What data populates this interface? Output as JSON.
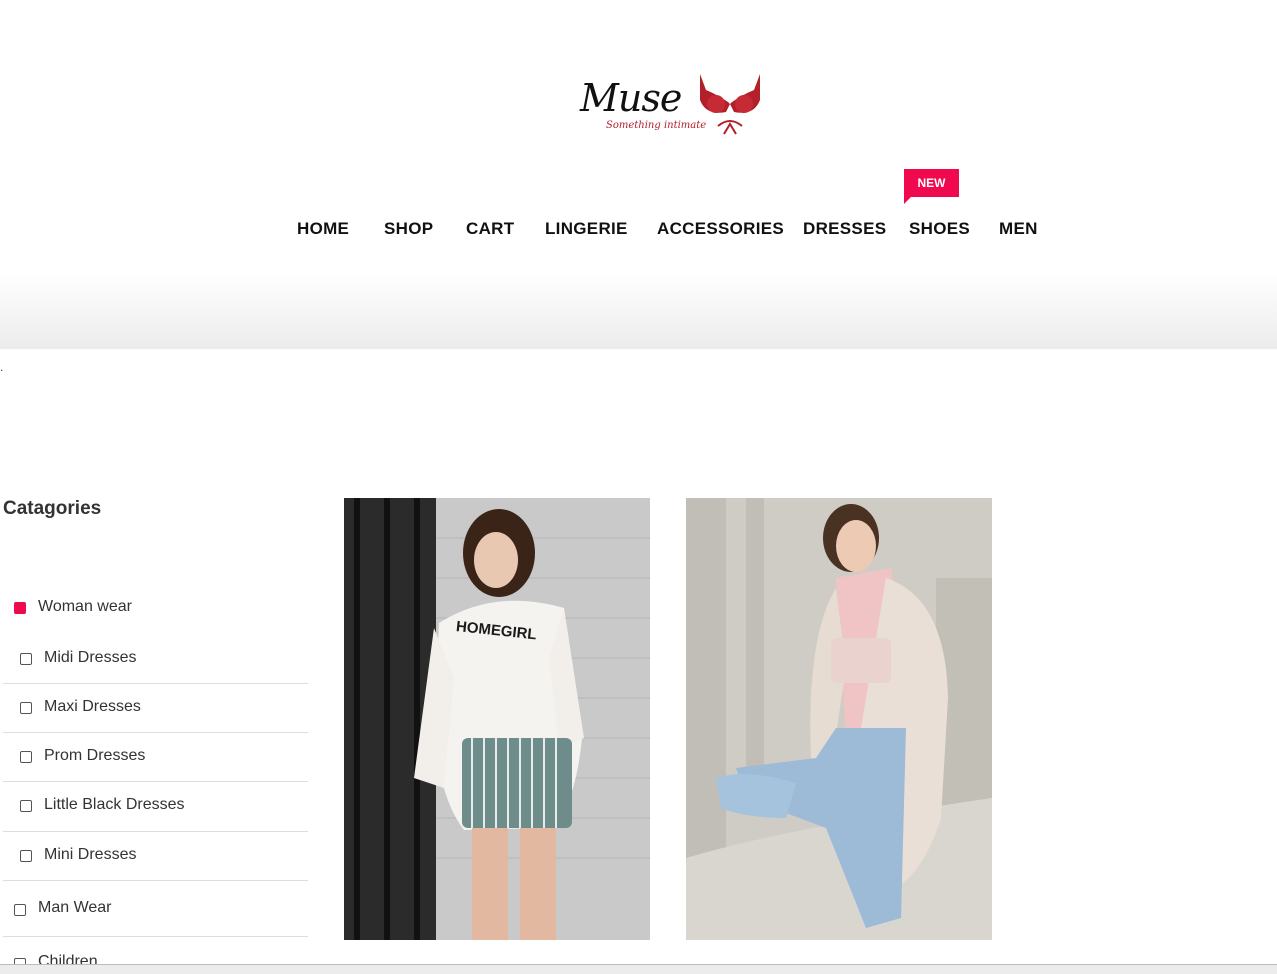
{
  "brand": {
    "name": "Muse",
    "tagline": "Something intimate"
  },
  "nav": {
    "items": [
      "HOME",
      "SHOP",
      "CART",
      "LINGERIE",
      "ACCESSORIES",
      "DRESSES",
      "SHOES",
      "MEN"
    ],
    "badge": "NEW"
  },
  "stray_text": ".",
  "sidebar": {
    "title": "Catagories",
    "categories": [
      {
        "label": "Woman wear",
        "active": true
      },
      {
        "label": "Midi Dresses",
        "active": false
      },
      {
        "label": "Maxi Dresses",
        "active": false
      },
      {
        "label": "Prom Dresses",
        "active": false
      },
      {
        "label": "Little Black Dresses",
        "active": false
      },
      {
        "label": "Mini Dresses",
        "active": false
      },
      {
        "label": "Man Wear",
        "active": false
      },
      {
        "label": "Children",
        "active": false
      }
    ]
  },
  "products": [
    {
      "image_text": "HOMEGIRL"
    },
    {
      "image_text": ""
    }
  ],
  "colors": {
    "accent": "#f0094f",
    "brand_red": "#b3202a"
  }
}
